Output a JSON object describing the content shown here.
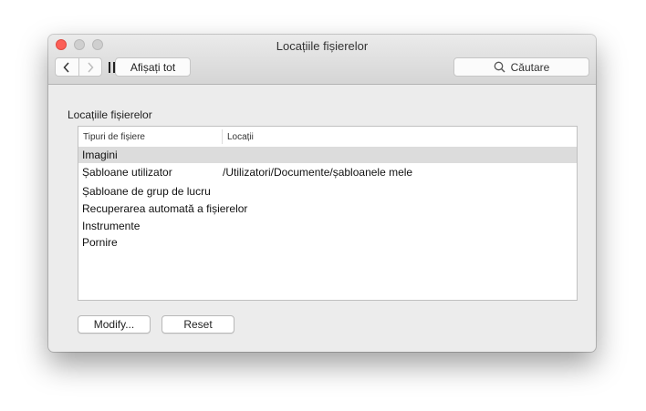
{
  "window": {
    "title": "Locațiile fișierelor"
  },
  "toolbar": {
    "back_icon": "chevron-left-icon",
    "forward_icon": "chevron-right-icon",
    "grid_icon": "grid-icon",
    "show_all_label": "Afișați tot",
    "search_icon": "search-icon",
    "search_placeholder": "Căutare"
  },
  "section": {
    "label": "Locațiile fișierelor"
  },
  "table": {
    "headers": [
      "Tipuri de fișiere",
      "Locații"
    ],
    "rows": [
      {
        "type": "Imagini",
        "location": "",
        "selected": true
      },
      {
        "type": "Șabloane utilizator",
        "location": "/Utilizatori/Documente/șabloanele mele",
        "selected": false
      },
      {
        "type": "Șabloane de grup de lucru",
        "location": "",
        "selected": false
      },
      {
        "type": "Recuperarea automată a fișierelor",
        "location": "",
        "selected": false
      },
      {
        "type": "Instrumente",
        "location": "",
        "selected": false
      },
      {
        "type": "Pornire",
        "location": "",
        "selected": false
      }
    ]
  },
  "buttons": {
    "modify_label": "Modify...",
    "reset_label": "Reset"
  },
  "colors": {
    "close_button": "#fc5f57",
    "inactive_button": "#cfcfcf",
    "selected_row": "#dcdcdc",
    "window_background": "#ececec"
  }
}
